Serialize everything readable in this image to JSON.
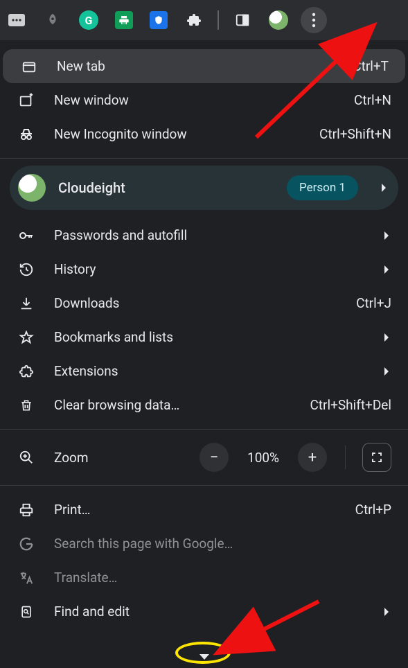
{
  "menu": {
    "new_tab": {
      "label": "New tab",
      "shortcut": "Ctrl+T"
    },
    "new_window": {
      "label": "New window",
      "shortcut": "Ctrl+N"
    },
    "incognito": {
      "label": "New Incognito window",
      "shortcut": "Ctrl+Shift+N"
    },
    "profile": {
      "name": "Cloudeight",
      "badge": "Person 1"
    },
    "passwords": {
      "label": "Passwords and autofill"
    },
    "history": {
      "label": "History"
    },
    "downloads": {
      "label": "Downloads",
      "shortcut": "Ctrl+J"
    },
    "bookmarks": {
      "label": "Bookmarks and lists"
    },
    "extensions": {
      "label": "Extensions"
    },
    "clear_data": {
      "label": "Clear browsing data…",
      "shortcut": "Ctrl+Shift+Del"
    },
    "zoom": {
      "label": "Zoom",
      "value": "100%"
    },
    "print": {
      "label": "Print…",
      "shortcut": "Ctrl+P"
    },
    "search_google": {
      "label": "Search this page with Google…"
    },
    "translate": {
      "label": "Translate…"
    },
    "find_edit": {
      "label": "Find and edit"
    }
  }
}
